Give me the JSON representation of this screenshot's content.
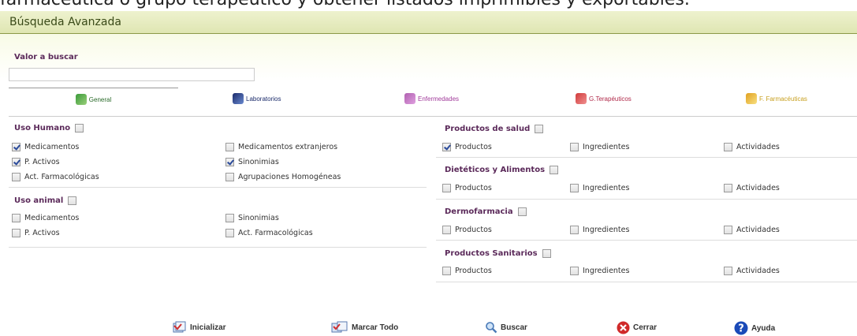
{
  "caption": "farmacéutica o grupo terapéutico y obtener listados imprimibles y exportables.",
  "window": {
    "title": "Búsqueda Avanzada"
  },
  "search": {
    "label": "Valor a buscar",
    "value": "",
    "placeholder": ""
  },
  "tabs": [
    {
      "label": "General",
      "color": "#2a6a2a"
    },
    {
      "label": "Laboratorios",
      "color": "#1a2a6a"
    },
    {
      "label": "Enfermedades",
      "color": "#a03a9a"
    },
    {
      "label": "G.Terapéuticos",
      "color": "#b02a4a"
    },
    {
      "label": "F. Farmacéuticas",
      "color": "#c8a020"
    }
  ],
  "uso_humano": {
    "title": "Uso Humano",
    "checked": false,
    "items": [
      {
        "label": "Medicamentos",
        "checked": true
      },
      {
        "label": "Medicamentos extranjeros",
        "checked": false
      },
      {
        "label": "P. Activos",
        "checked": true
      },
      {
        "label": "Sinonimias",
        "checked": true
      },
      {
        "label": "Act. Farmacológicas",
        "checked": false
      },
      {
        "label": "Agrupaciones Homogéneas",
        "checked": false
      }
    ]
  },
  "uso_animal": {
    "title": "Uso animal",
    "checked": false,
    "items": [
      {
        "label": "Medicamentos",
        "checked": false
      },
      {
        "label": "Sinonimias",
        "checked": false
      },
      {
        "label": "P. Activos",
        "checked": false
      },
      {
        "label": "Act. Farmacológicas",
        "checked": false
      }
    ]
  },
  "productos_salud": {
    "title": "Productos de salud",
    "checked": false,
    "items": [
      {
        "label": "Productos",
        "checked": true
      },
      {
        "label": "Ingredientes",
        "checked": false
      },
      {
        "label": "Actividades",
        "checked": false
      }
    ]
  },
  "dieteticos": {
    "title": "Dietéticos y Alimentos",
    "checked": false,
    "items": [
      {
        "label": "Productos",
        "checked": false
      },
      {
        "label": "Ingredientes",
        "checked": false
      },
      {
        "label": "Actividades",
        "checked": false
      }
    ]
  },
  "dermofarmacia": {
    "title": "Dermofarmacia",
    "checked": false,
    "items": [
      {
        "label": "Productos",
        "checked": false
      },
      {
        "label": "Ingredientes",
        "checked": false
      },
      {
        "label": "Actividades",
        "checked": false
      }
    ]
  },
  "sanitarios": {
    "title": "Productos Sanitarios",
    "checked": false,
    "items": [
      {
        "label": "Productos",
        "checked": false
      },
      {
        "label": "Ingredientes",
        "checked": false
      },
      {
        "label": "Actividades",
        "checked": false
      }
    ]
  },
  "buttons": [
    {
      "label": "Inicializar",
      "icon": "reset-icon"
    },
    {
      "label": "Marcar Todo",
      "icon": "mark-all-icon"
    },
    {
      "label": "Buscar",
      "icon": "search-icon"
    },
    {
      "label": "Cerrar",
      "icon": "close-icon"
    },
    {
      "label": "Ayuda",
      "icon": "help-icon"
    }
  ]
}
